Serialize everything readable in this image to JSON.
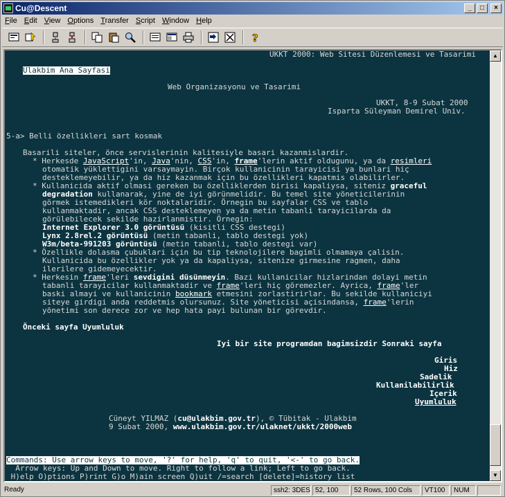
{
  "window": {
    "title": "Cu@Descent"
  },
  "menu": [
    "File",
    "Edit",
    "View",
    "Options",
    "Transfer",
    "Script",
    "Window",
    "Help"
  ],
  "menu_underline": [
    "F",
    "E",
    "V",
    "O",
    "T",
    "S",
    "W",
    "H"
  ],
  "toolbar_icons": [
    "connect-icon",
    "quick-connect-icon",
    "disconnect-icon",
    "reconnect-icon",
    "copy-icon",
    "paste-icon",
    "find-icon",
    "session-options-icon",
    "global-options-icon",
    "print-icon",
    "sftp-icon",
    "keymap-icon",
    "help-icon"
  ],
  "terminal": {
    "header": "UKKT 2000: Web Sitesi Düzenlemesi ve Tasarimi",
    "home_link": "Ulakbim Ana Sayfasi",
    "subtitle": "Web Organizasyonu ve Tasarimi",
    "event_line1": "UKKT, 8-9 Subat 2000",
    "event_line2": "Isparta Süleyman Demirel Univ.",
    "section": "5-a> Belli özellikleri sart kosmak",
    "intro": "Basarili siteler, önce servislerinin kalitesiyle basari kazanmislardir.",
    "b1_l1_pre": "* Herkesde ",
    "b1_l1_js": "JavaScript",
    "b1_l1_mid1": "'in, ",
    "b1_l1_java": "Java",
    "b1_l1_mid2": "'nin, ",
    "b1_l1_css": "CSS",
    "b1_l1_mid3": "'in, ",
    "b1_l1_frame": "frame",
    "b1_l1_mid4": "'lerin aktif oldugunu, ya da ",
    "b1_l1_resim": "resimleri",
    "b1_l2": "otomatik yüklettigini varsaymayin. Birçok kullanicinin tarayicisi ya bunlari hiç",
    "b1_l3": "desteklemeyebilir, ya da hiz kazanmak için bu özellikleri kapatmis olabilirler.",
    "b2_l1_pre": "* Kullanicida aktif olmasi gereken bu özelliklerden birisi kapaliysa, siteniz ",
    "b2_l1_bold": "graceful",
    "b2_l2_bold": "degradation",
    "b2_l2_rest": " kullanarak, yine de iyi görünmelidir. Bu temel site yöneticilerinin",
    "b2_l3": "görmek istemedikleri kör noktalaridir. Örnegin bu sayfalar CSS ve tablo",
    "b2_l4": "kullanmaktadir, ancak CSS desteklemeyen ya da metin tabanli tarayicilarda da",
    "b2_l5": "görülebilecek sekilde hazirlanmistir. Örnegin:",
    "b2_l6_bold": "Internet Explorer 3.0 görüntüsü",
    "b2_l6_rest": " (kisitli CSS destegi)",
    "b2_l7_bold": "Lynx 2.8rel.2 görüntüsü",
    "b2_l7_rest": " (metin tabanli, tablo destegi yok)",
    "b2_l8_bold": "W3m/beta-991203 görüntüsü",
    "b2_l8_rest": " (metin tabanli, tablo destegi var)",
    "b3_l1": "* Özellikle dolasma çubuklari için bu tip teknolojilere bagimli olmamaya çalisin.",
    "b3_l2": "Kullanicida bu özellikler yok ya da kapaliysa, sitenize girmesine ragmen, daha",
    "b3_l3": "ilerilere gidemeyecektir.",
    "b4_l1_pre": "* Herkesin ",
    "b4_l1_frame": "frame",
    "b4_l1_mid": "'leri ",
    "b4_l1_bold": "sevdigini düsünmeyin",
    "b4_l1_rest": ". Bazi kullanicilar hizlarindan dolayi metin",
    "b4_l2_pre": "tabanli tarayicilar kullanmaktadir ve ",
    "b4_l2_frame": "frame",
    "b4_l2_mid": "'leri hiç göremezler. Ayrica, ",
    "b4_l2_frame2": "frame",
    "b4_l2_rest": "'ler",
    "b4_l3_pre": "baski almayi ve kullanicinin ",
    "b4_l3_link": "bookmark",
    "b4_l3_rest": " etmesini zorlastirirlar. Bu sekilde kullaniciyi",
    "b4_l4_pre": "siteye girdigi anda reddetmis olursunuz. Site yöneticisi açisindansa, ",
    "b4_l4_frame": "frame",
    "b4_l4_rest": "'lerin",
    "b4_l5": "yönetimi son derece zor ve hep hata payi bulunan bir görevdir.",
    "prev": "Önceki sayfa Uyumluluk",
    "next": "Iyi bir site programdan bagimsizdir Sonraki sayfa",
    "nav": [
      "Giris",
      "Hiz",
      "Sadelik",
      "Kullanilabilirlik",
      "Içerik",
      "Uyumluluk"
    ],
    "author_pre": "Cüneyt YILMAZ (",
    "author_email": "cu@ulakbim.gov.tr",
    "author_rest": "), © Tübitak - Ulakbim",
    "date_pre": "9 Subat 2000, ",
    "date_url": "www.ulakbim.gov.tr/ulaknet/ukkt/2000web",
    "cmd1": "Commands: Use arrow keys to move, '?' for help, 'q' to quit, '<-' to go back.",
    "cmd2": "  Arrow keys: Up and Down to move. Right to follow a link; Left to go back.",
    "cmd3": " H)elp O)ptions P)rint G)o M)ain screen Q)uit /=search [delete]=history list"
  },
  "status": {
    "ready": "Ready",
    "conn": "ssh2: 3DES",
    "pos": "52, 100",
    "size": "52 Rows, 100 Cols",
    "term": "VT100",
    "num": "NUM"
  }
}
